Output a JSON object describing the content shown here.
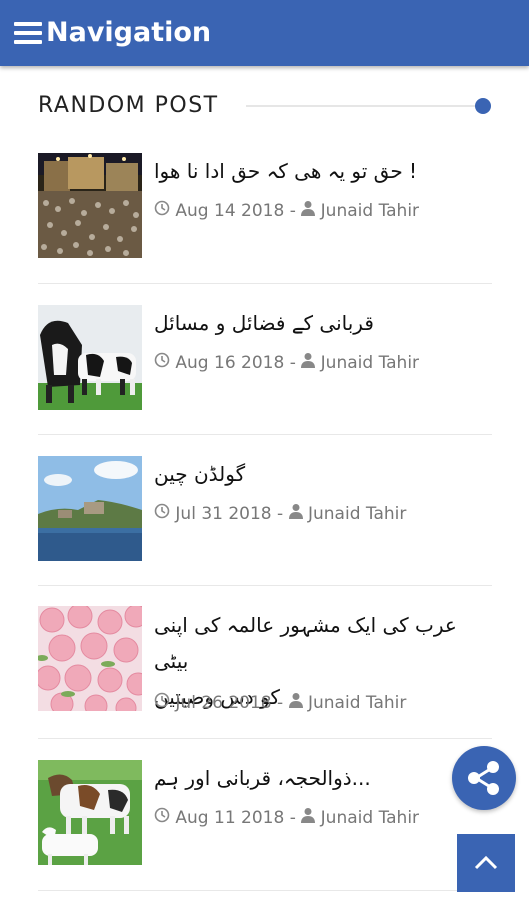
{
  "header": {
    "title": "Navigation"
  },
  "section": {
    "title": "RANDOM POST"
  },
  "posts": [
    {
      "title": "! حق تو یہ ھی کہ حق ادا نا ھوا",
      "date": "Aug 14 2018",
      "sep": "-",
      "author": "Junaid Tahir"
    },
    {
      "title": "قربانی کے فضائل و مسائل",
      "date": "Aug 16 2018",
      "sep": "-",
      "author": "Junaid Tahir"
    },
    {
      "title": "گولڈن چین",
      "date": "Jul 31 2018",
      "sep": "-",
      "author": "Junaid Tahir"
    },
    {
      "title_line1": "عرب کی ایک مشہور عالمہ کی اپنی بیٹی",
      "title_line2": "کو دس وصیتیں",
      "date": "Jul 26 2018",
      "sep": "-",
      "author": "Junaid Tahir"
    },
    {
      "title": "...ذوالحجہ، قربانی اور ہم",
      "date": "Aug 11 2018",
      "sep": "-",
      "author": "Junaid Tahir"
    }
  ],
  "colors": {
    "accent": "#3a64b3",
    "meta": "#777777"
  },
  "icons": {
    "menu": "menu-icon",
    "clock": "clock-icon",
    "user": "user-icon",
    "share": "share-icon",
    "up": "chevron-up-icon"
  }
}
